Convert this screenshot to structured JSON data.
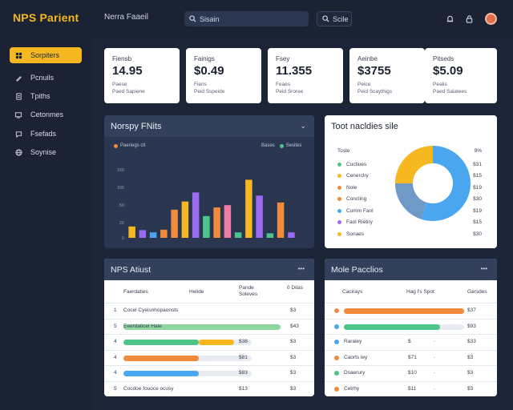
{
  "app": {
    "logo": "NPS Parient",
    "page_title": "Nerra Faaeil"
  },
  "header": {
    "search_placeholder": "Sisain",
    "button_label": "Scile",
    "icons": [
      "search-icon",
      "bell-icon",
      "lock-icon",
      "user-avatar"
    ]
  },
  "sidebar": {
    "items": [
      {
        "label": "Sorpiters",
        "icon": "dashboard-icon",
        "active": true
      },
      {
        "label": "Pcnuils",
        "icon": "pen-icon",
        "active": false
      },
      {
        "label": "Tpiths",
        "icon": "document-icon",
        "active": false
      },
      {
        "label": "Cetonmes",
        "icon": "monitor-icon",
        "active": false
      },
      {
        "label": "Fsefads",
        "icon": "chat-icon",
        "active": false
      },
      {
        "label": "Soynise",
        "icon": "globe-icon",
        "active": false
      }
    ]
  },
  "stats": [
    {
      "label": "Fiensb",
      "value": "14.95",
      "sub1": "Paese",
      "sub2": "Paed Sapiene"
    },
    {
      "label": "Fainigs",
      "value": "$0.49",
      "sub1": "Fiens",
      "sub2": "Peid Sspeide"
    },
    {
      "label": "Fsey",
      "value": "11.355",
      "sub1": "Feaes",
      "sub2": "Peid Sroree"
    },
    {
      "label": "Aeinbe",
      "value": "$3755",
      "sub1": "Peice",
      "sub2": "Peid Scaythigs"
    },
    {
      "label": "Pitseds",
      "value": "$5.09",
      "sub1": "Pealis",
      "sub2": "Paed Saiatees"
    }
  ],
  "chart_panel": {
    "title": "Norspy FNits",
    "legend_left": "Paeriegs cit",
    "legend_right": [
      "Bases",
      "Sesites"
    ],
    "colors": {
      "orange": "#f08a3c",
      "green": "#4fc48a",
      "blue": "#4aa7ef"
    },
    "y_ticks": [
      "150",
      "100",
      "50",
      "20",
      "0"
    ]
  },
  "chart_data": {
    "type": "bar",
    "title": "Norspy FNits",
    "xlabel": "",
    "ylabel": "",
    "ylim": [
      0,
      150
    ],
    "y_ticks": [
      150,
      100,
      50,
      20,
      0
    ],
    "values": [
      25,
      17,
      12,
      18,
      62,
      80,
      100,
      48,
      67,
      72,
      12,
      128,
      93,
      10,
      78,
      12
    ],
    "colors": [
      "#f5b820",
      "#9b6cf2",
      "#4aa7ef",
      "#f08a3c",
      "#f08a3c",
      "#f5b820",
      "#9b6cf2",
      "#4fc48a",
      "#f08a3c",
      "#f07aa8",
      "#4fc48a",
      "#f5b820",
      "#9b6cf2",
      "#4fc48a",
      "#f08a3c",
      "#9b6cf2"
    ]
  },
  "donut_panel": {
    "title": "Toot nacldies sile",
    "header_label": "Toste",
    "header_value": "9%",
    "rows": [
      {
        "label": "Cuctiues",
        "value": "$31",
        "color": "#4fc48a"
      },
      {
        "label": "Cenerclry",
        "value": "$15",
        "color": "#f5b820"
      },
      {
        "label": "Nole",
        "value": "$19",
        "color": "#f08a3c"
      },
      {
        "label": "Concling",
        "value": "$30",
        "color": "#f08a3c"
      },
      {
        "label": "Cumm Fanl",
        "value": "$19",
        "color": "#4aa7ef"
      },
      {
        "label": "Faol Rietiry",
        "value": "$15",
        "color": "#9b6cf2"
      },
      {
        "label": "Sonaes",
        "value": "$30",
        "color": "#f5b820"
      }
    ],
    "slices": [
      {
        "label": "blue",
        "value": 55,
        "color": "#4aa7ef"
      },
      {
        "label": "steel",
        "value": 20,
        "color": "#6f9ac8"
      },
      {
        "label": "yellow",
        "value": 25,
        "color": "#f5b820"
      }
    ]
  },
  "table_left": {
    "title": "NPS Atiust",
    "columns": [
      "Faerdaties",
      "Helide",
      "Pande Soleves",
      "0 Dilas"
    ],
    "rows": [
      {
        "id": "1",
        "name": "Cocel Cyeisnhopaonsts",
        "amount": "",
        "count": "$3",
        "bar_pct": 0,
        "bar_color": ""
      },
      {
        "id": "5",
        "name": "Eeerdaticel Haie",
        "amount": "",
        "count": "$43",
        "bar_pct": 100,
        "bar_color": "#8fd6a0"
      },
      {
        "id": "4",
        "name": "",
        "amount": "$38",
        "count": "$3",
        "bar_pct": 100,
        "bar_color": "#4fc48a",
        "bar2_pct": 45,
        "bar2_color": "#f5b820"
      },
      {
        "id": "4",
        "name": "",
        "amount": "$81",
        "count": "$3",
        "bar_pct": 100,
        "bar_color": "#f08a3c"
      },
      {
        "id": "4",
        "name": "",
        "amount": "$83",
        "count": "$3",
        "bar_pct": 100,
        "bar_color": "#4aa7ef"
      },
      {
        "id": "5",
        "name": "Cocdoe fouoce ocusy",
        "amount": "$13",
        "count": "$3",
        "bar_pct": 0,
        "bar_color": ""
      }
    ]
  },
  "table_right": {
    "title": "Mole Pacclios",
    "columns": [
      "Cacirays",
      "Hag l's Spot",
      "Garsdes"
    ],
    "rows": [
      {
        "name": "",
        "mid": "",
        "value": "$37",
        "color": "#f08a3c",
        "bar_pct": 100,
        "bar_color": "#f08a3c"
      },
      {
        "name": "",
        "mid": "",
        "value": "$93",
        "color": "#4aa7ef",
        "bar_pct": 80,
        "bar_color": "#4fc48a"
      },
      {
        "name": "Raraley",
        "mid": "$",
        "value": "$33",
        "color": "#4aa7ef",
        "bar_pct": 0,
        "bar_color": ""
      },
      {
        "name": "Caorts ley",
        "mid": "$71",
        "value": "$3",
        "color": "#f08a3c",
        "bar_pct": 0,
        "bar_color": ""
      },
      {
        "name": "Dsaerury",
        "mid": "$10",
        "value": "$3",
        "color": "#4fc48a",
        "bar_pct": 0,
        "bar_color": ""
      },
      {
        "name": "Cetrhy",
        "mid": "$11",
        "value": "$3",
        "color": "#f08a3c",
        "bar_pct": 0,
        "bar_color": ""
      }
    ]
  }
}
